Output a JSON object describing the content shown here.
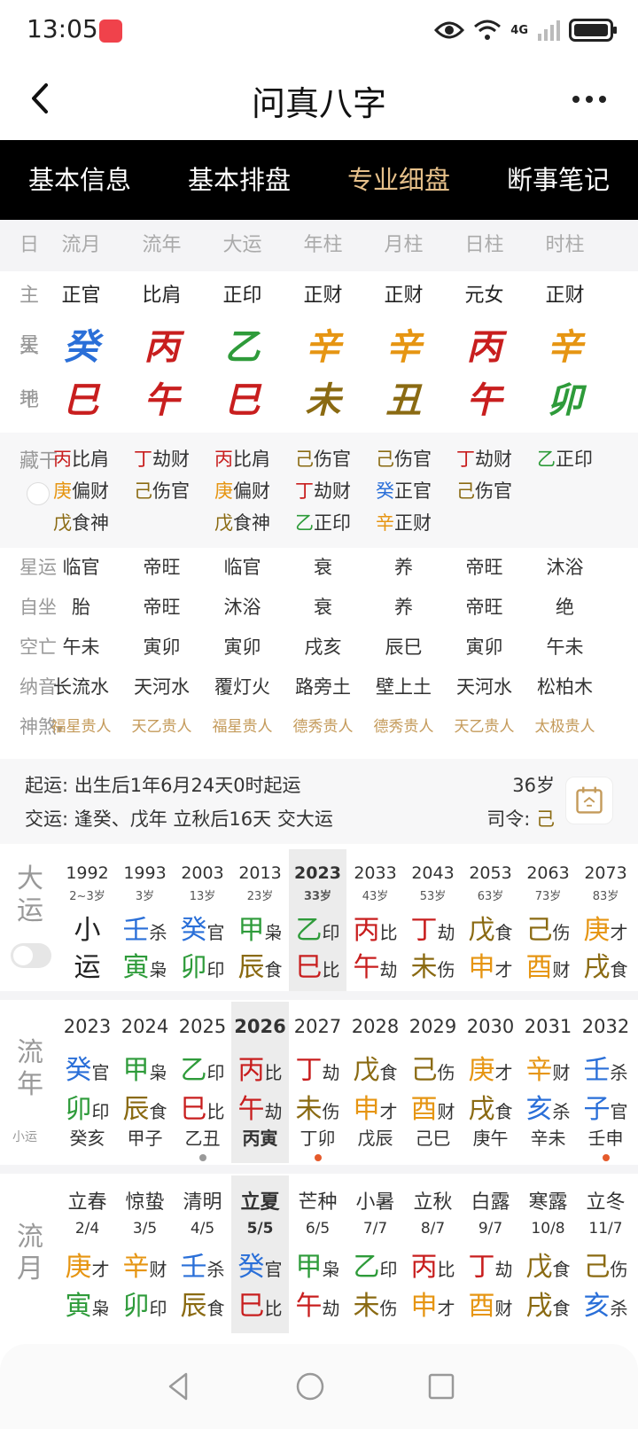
{
  "status": {
    "time": "13:05",
    "network": "4G"
  },
  "header": {
    "title": "问真八字"
  },
  "tabs": [
    {
      "label": "基本信息",
      "active": false
    },
    {
      "label": "基本排盘",
      "active": false
    },
    {
      "label": "专业细盘",
      "active": true
    },
    {
      "label": "断事笔记",
      "active": false
    }
  ],
  "columns": [
    "日期",
    "流月",
    "流年",
    "大运",
    "年柱",
    "月柱",
    "日柱",
    "时柱"
  ],
  "rows": {
    "zhuxing": {
      "label": "主星",
      "values": [
        "正官",
        "比肩",
        "正印",
        "正财",
        "正财",
        "元女",
        "正财"
      ]
    },
    "tiangan": {
      "label": "天干",
      "values": [
        {
          "t": "癸",
          "e": "water"
        },
        {
          "t": "丙",
          "e": "fire"
        },
        {
          "t": "乙",
          "e": "wood"
        },
        {
          "t": "辛",
          "e": "metal"
        },
        {
          "t": "辛",
          "e": "metal"
        },
        {
          "t": "丙",
          "e": "fire"
        },
        {
          "t": "辛",
          "e": "metal"
        }
      ]
    },
    "dizhi": {
      "label": "地支",
      "values": [
        {
          "t": "巳",
          "e": "fire"
        },
        {
          "t": "午",
          "e": "fire"
        },
        {
          "t": "巳",
          "e": "fire"
        },
        {
          "t": "未",
          "e": "earth"
        },
        {
          "t": "丑",
          "e": "earth"
        },
        {
          "t": "午",
          "e": "fire"
        },
        {
          "t": "卯",
          "e": "wood"
        }
      ]
    }
  },
  "canggan": {
    "label": "藏干",
    "cols": [
      [
        {
          "g": "丙",
          "e": "fire",
          "s": "比肩"
        },
        {
          "g": "庚",
          "e": "metal",
          "s": "偏财"
        },
        {
          "g": "戊",
          "e": "earth",
          "s": "食神"
        }
      ],
      [
        {
          "g": "丁",
          "e": "fire",
          "s": "劫财"
        },
        {
          "g": "己",
          "e": "earth",
          "s": "伤官"
        }
      ],
      [
        {
          "g": "丙",
          "e": "fire",
          "s": "比肩"
        },
        {
          "g": "庚",
          "e": "metal",
          "s": "偏财"
        },
        {
          "g": "戊",
          "e": "earth",
          "s": "食神"
        }
      ],
      [
        {
          "g": "己",
          "e": "earth",
          "s": "伤官"
        },
        {
          "g": "丁",
          "e": "fire",
          "s": "劫财"
        },
        {
          "g": "乙",
          "e": "wood",
          "s": "正印"
        }
      ],
      [
        {
          "g": "己",
          "e": "earth",
          "s": "伤官"
        },
        {
          "g": "癸",
          "e": "water",
          "s": "正官"
        },
        {
          "g": "辛",
          "e": "metal",
          "s": "正财"
        }
      ],
      [
        {
          "g": "丁",
          "e": "fire",
          "s": "劫财"
        },
        {
          "g": "己",
          "e": "earth",
          "s": "伤官"
        }
      ],
      [
        {
          "g": "乙",
          "e": "wood",
          "s": "正印"
        }
      ]
    ]
  },
  "info_rows": [
    {
      "label": "星运",
      "values": [
        "临官",
        "帝旺",
        "临官",
        "衰",
        "养",
        "帝旺",
        "沐浴"
      ]
    },
    {
      "label": "自坐",
      "values": [
        "胎",
        "帝旺",
        "沐浴",
        "衰",
        "养",
        "帝旺",
        "绝"
      ]
    },
    {
      "label": "空亡",
      "values": [
        "午未",
        "寅卯",
        "寅卯",
        "戌亥",
        "辰巳",
        "寅卯",
        "午未"
      ]
    },
    {
      "label": "纳音",
      "values": [
        "长流水",
        "天河水",
        "覆灯火",
        "路旁土",
        "壁上土",
        "天河水",
        "松柏木"
      ]
    }
  ],
  "shensha": {
    "label": "神煞",
    "values": [
      "福星贵人",
      "天乙贵人",
      "福星贵人",
      "德秀贵人",
      "德秀贵人",
      "天乙贵人",
      "太极贵人"
    ]
  },
  "qiyun": {
    "line1": "起运:   出生后1年6月24天0时起运",
    "line2": "交运:   逢癸、戊年 立秋后16天 交大运",
    "age": "36岁",
    "siling_label": "司令:",
    "siling_value": "己"
  },
  "dayun": {
    "side": "大运",
    "cols": [
      {
        "yr": "1992",
        "ag": "2~3岁",
        "g1": {
          "t": "小",
          "e": "",
          "s": ""
        },
        "g2": {
          "t": "运",
          "e": "",
          "s": ""
        }
      },
      {
        "yr": "1993",
        "ag": "3岁",
        "g1": {
          "t": "壬",
          "e": "water",
          "s": "杀"
        },
        "g2": {
          "t": "寅",
          "e": "wood",
          "s": "枭"
        }
      },
      {
        "yr": "2003",
        "ag": "13岁",
        "g1": {
          "t": "癸",
          "e": "water",
          "s": "官"
        },
        "g2": {
          "t": "卯",
          "e": "wood",
          "s": "印"
        }
      },
      {
        "yr": "2013",
        "ag": "23岁",
        "g1": {
          "t": "甲",
          "e": "wood",
          "s": "枭"
        },
        "g2": {
          "t": "辰",
          "e": "earth",
          "s": "食"
        }
      },
      {
        "yr": "2023",
        "ag": "33岁",
        "hl": true,
        "g1": {
          "t": "乙",
          "e": "wood",
          "s": "印"
        },
        "g2": {
          "t": "巳",
          "e": "fire",
          "s": "比"
        }
      },
      {
        "yr": "2033",
        "ag": "43岁",
        "g1": {
          "t": "丙",
          "e": "fire",
          "s": "比"
        },
        "g2": {
          "t": "午",
          "e": "fire",
          "s": "劫"
        }
      },
      {
        "yr": "2043",
        "ag": "53岁",
        "g1": {
          "t": "丁",
          "e": "fire",
          "s": "劫"
        },
        "g2": {
          "t": "未",
          "e": "earth",
          "s": "伤"
        }
      },
      {
        "yr": "2053",
        "ag": "63岁",
        "g1": {
          "t": "戊",
          "e": "earth",
          "s": "食"
        },
        "g2": {
          "t": "申",
          "e": "metal",
          "s": "才"
        }
      },
      {
        "yr": "2063",
        "ag": "73岁",
        "g1": {
          "t": "己",
          "e": "earth",
          "s": "伤"
        },
        "g2": {
          "t": "酉",
          "e": "metal",
          "s": "财"
        }
      },
      {
        "yr": "2073",
        "ag": "83岁",
        "g1": {
          "t": "庚",
          "e": "metal",
          "s": "才"
        },
        "g2": {
          "t": "戌",
          "e": "earth",
          "s": "食"
        }
      }
    ]
  },
  "liunian": {
    "side": "流年",
    "xiaoyun_label": "小运",
    "cols": [
      {
        "yr": "2023",
        "g1": {
          "t": "癸",
          "e": "water",
          "s": "官"
        },
        "g2": {
          "t": "卯",
          "e": "wood",
          "s": "印"
        },
        "xy": "癸亥",
        "dot": ""
      },
      {
        "yr": "2024",
        "g1": {
          "t": "甲",
          "e": "wood",
          "s": "枭"
        },
        "g2": {
          "t": "辰",
          "e": "earth",
          "s": "食"
        },
        "xy": "甲子",
        "dot": ""
      },
      {
        "yr": "2025",
        "g1": {
          "t": "乙",
          "e": "wood",
          "s": "印"
        },
        "g2": {
          "t": "巳",
          "e": "fire",
          "s": "比"
        },
        "xy": "乙丑",
        "dot": "#999999"
      },
      {
        "yr": "2026",
        "hl": true,
        "g1": {
          "t": "丙",
          "e": "fire",
          "s": "比"
        },
        "g2": {
          "t": "午",
          "e": "fire",
          "s": "劫"
        },
        "xy": "丙寅",
        "dot": ""
      },
      {
        "yr": "2027",
        "g1": {
          "t": "丁",
          "e": "fire",
          "s": "劫"
        },
        "g2": {
          "t": "未",
          "e": "earth",
          "s": "伤"
        },
        "xy": "丁卯",
        "dot": "#e55a2b"
      },
      {
        "yr": "2028",
        "g1": {
          "t": "戊",
          "e": "earth",
          "s": "食"
        },
        "g2": {
          "t": "申",
          "e": "metal",
          "s": "才"
        },
        "xy": "戊辰",
        "dot": ""
      },
      {
        "yr": "2029",
        "g1": {
          "t": "己",
          "e": "earth",
          "s": "伤"
        },
        "g2": {
          "t": "酉",
          "e": "metal",
          "s": "财"
        },
        "xy": "己巳",
        "dot": ""
      },
      {
        "yr": "2030",
        "g1": {
          "t": "庚",
          "e": "metal",
          "s": "才"
        },
        "g2": {
          "t": "戌",
          "e": "earth",
          "s": "食"
        },
        "xy": "庚午",
        "dot": ""
      },
      {
        "yr": "2031",
        "g1": {
          "t": "辛",
          "e": "metal",
          "s": "财"
        },
        "g2": {
          "t": "亥",
          "e": "water",
          "s": "杀"
        },
        "xy": "辛未",
        "dot": ""
      },
      {
        "yr": "2032",
        "g1": {
          "t": "壬",
          "e": "water",
          "s": "杀"
        },
        "g2": {
          "t": "子",
          "e": "water",
          "s": "官"
        },
        "xy": "壬申",
        "dot": "#e55a2b"
      }
    ]
  },
  "liuyue": {
    "side": "流月",
    "cols": [
      {
        "term": "立春",
        "date": "2/4",
        "g1": {
          "t": "庚",
          "e": "metal",
          "s": "才"
        },
        "g2": {
          "t": "寅",
          "e": "wood",
          "s": "枭"
        }
      },
      {
        "term": "惊蛰",
        "date": "3/5",
        "g1": {
          "t": "辛",
          "e": "metal",
          "s": "财"
        },
        "g2": {
          "t": "卯",
          "e": "wood",
          "s": "印"
        }
      },
      {
        "term": "清明",
        "date": "4/5",
        "g1": {
          "t": "壬",
          "e": "water",
          "s": "杀"
        },
        "g2": {
          "t": "辰",
          "e": "earth",
          "s": "食"
        }
      },
      {
        "term": "立夏",
        "date": "5/5",
        "hl": true,
        "g1": {
          "t": "癸",
          "e": "water",
          "s": "官"
        },
        "g2": {
          "t": "巳",
          "e": "fire",
          "s": "比"
        }
      },
      {
        "term": "芒种",
        "date": "6/5",
        "g1": {
          "t": "甲",
          "e": "wood",
          "s": "枭"
        },
        "g2": {
          "t": "午",
          "e": "fire",
          "s": "劫"
        }
      },
      {
        "term": "小暑",
        "date": "7/7",
        "g1": {
          "t": "乙",
          "e": "wood",
          "s": "印"
        },
        "g2": {
          "t": "未",
          "e": "earth",
          "s": "伤"
        }
      },
      {
        "term": "立秋",
        "date": "8/7",
        "g1": {
          "t": "丙",
          "e": "fire",
          "s": "比"
        },
        "g2": {
          "t": "申",
          "e": "metal",
          "s": "才"
        }
      },
      {
        "term": "白露",
        "date": "9/7",
        "g1": {
          "t": "丁",
          "e": "fire",
          "s": "劫"
        },
        "g2": {
          "t": "酉",
          "e": "metal",
          "s": "财"
        }
      },
      {
        "term": "寒露",
        "date": "10/8",
        "g1": {
          "t": "戊",
          "e": "earth",
          "s": "食"
        },
        "g2": {
          "t": "戌",
          "e": "earth",
          "s": "食"
        }
      },
      {
        "term": "立冬",
        "date": "11/7",
        "g1": {
          "t": "己",
          "e": "earth",
          "s": "伤"
        },
        "g2": {
          "t": "亥",
          "e": "water",
          "s": "杀"
        }
      }
    ]
  },
  "colors": {
    "water": "#2a6fd8",
    "fire": "#c81e1e",
    "wood": "#2e9b3a",
    "metal": "#e69512",
    "earth": "#8a6a12",
    "tab_active": "#e6c08a"
  },
  "icons": [
    "back-arrow-icon",
    "more-dots-icon",
    "eye-icon",
    "wifi-icon",
    "signal-icon",
    "battery-icon",
    "calendar-icon",
    "pin-icon",
    "chevron-down-icon"
  ]
}
